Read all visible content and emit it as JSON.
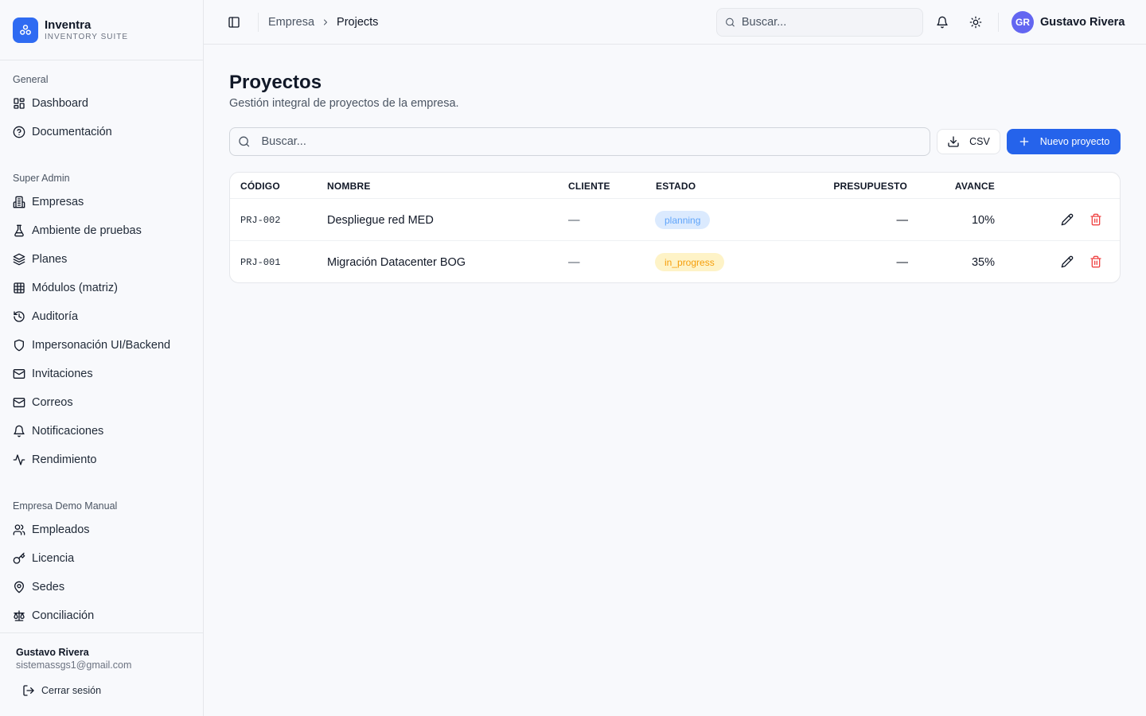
{
  "brand": {
    "name": "Inventra",
    "subtitle": "INVENTORY SUITE"
  },
  "sidebar": {
    "sections": [
      {
        "title": "General",
        "items": [
          {
            "label": "Dashboard",
            "icon": "grid-icon"
          },
          {
            "label": "Documentación",
            "icon": "help-circle-icon"
          }
        ]
      },
      {
        "title": "Super Admin",
        "items": [
          {
            "label": "Empresas",
            "icon": "building-icon"
          },
          {
            "label": "Ambiente de pruebas",
            "icon": "flask-icon"
          },
          {
            "label": "Planes",
            "icon": "layers-icon"
          },
          {
            "label": "Módulos (matriz)",
            "icon": "table-grid-icon"
          },
          {
            "label": "Auditoría",
            "icon": "history-icon"
          },
          {
            "label": "Impersonación UI/Backend",
            "icon": "shield-icon"
          },
          {
            "label": "Invitaciones",
            "icon": "mail-icon"
          },
          {
            "label": "Correos",
            "icon": "mail-icon"
          },
          {
            "label": "Notificaciones",
            "icon": "bell-icon"
          },
          {
            "label": "Rendimiento",
            "icon": "activity-icon"
          }
        ]
      },
      {
        "title": "Empresa Demo Manual",
        "items": [
          {
            "label": "Empleados",
            "icon": "users-icon"
          },
          {
            "label": "Licencia",
            "icon": "key-icon"
          },
          {
            "label": "Sedes",
            "icon": "map-pin-icon"
          },
          {
            "label": "Conciliación",
            "icon": "scale-icon"
          }
        ]
      }
    ],
    "footer": {
      "name": "Gustavo Rivera",
      "email": "sistemassgs1@gmail.com",
      "logout_label": "Cerrar sesión"
    }
  },
  "header": {
    "breadcrumb": {
      "parent": "Empresa",
      "current": "Projects"
    },
    "search_placeholder": "Buscar...",
    "user": {
      "initials": "GR",
      "name": "Gustavo Rivera"
    }
  },
  "page": {
    "title": "Proyectos",
    "subtitle": "Gestión integral de proyectos de la empresa.",
    "search_placeholder": "Buscar...",
    "csv_label": "CSV",
    "new_label": "Nuevo proyecto"
  },
  "table": {
    "columns": {
      "code": "CÓDIGO",
      "name": "NOMBRE",
      "client": "CLIENTE",
      "status": "ESTADO",
      "budget": "PRESUPUESTO",
      "progress": "AVANCE"
    },
    "rows": [
      {
        "code": "PRJ-002",
        "name": "Despliegue red MED",
        "client": "—",
        "status": "planning",
        "budget": "—",
        "progress": "10%"
      },
      {
        "code": "PRJ-001",
        "name": "Migración Datacenter BOG",
        "client": "—",
        "status": "in_progress",
        "budget": "—",
        "progress": "35%"
      }
    ]
  },
  "colors": {
    "accent": "#2563eb",
    "logo": "#2f6bf2",
    "avatar": "#6366f1",
    "badge_planning_bg": "#dbeafe",
    "badge_planning_text": "#60a5fa",
    "badge_progress_bg": "#fef3c7",
    "badge_progress_text": "#f59e0b",
    "danger": "#ef4444"
  }
}
